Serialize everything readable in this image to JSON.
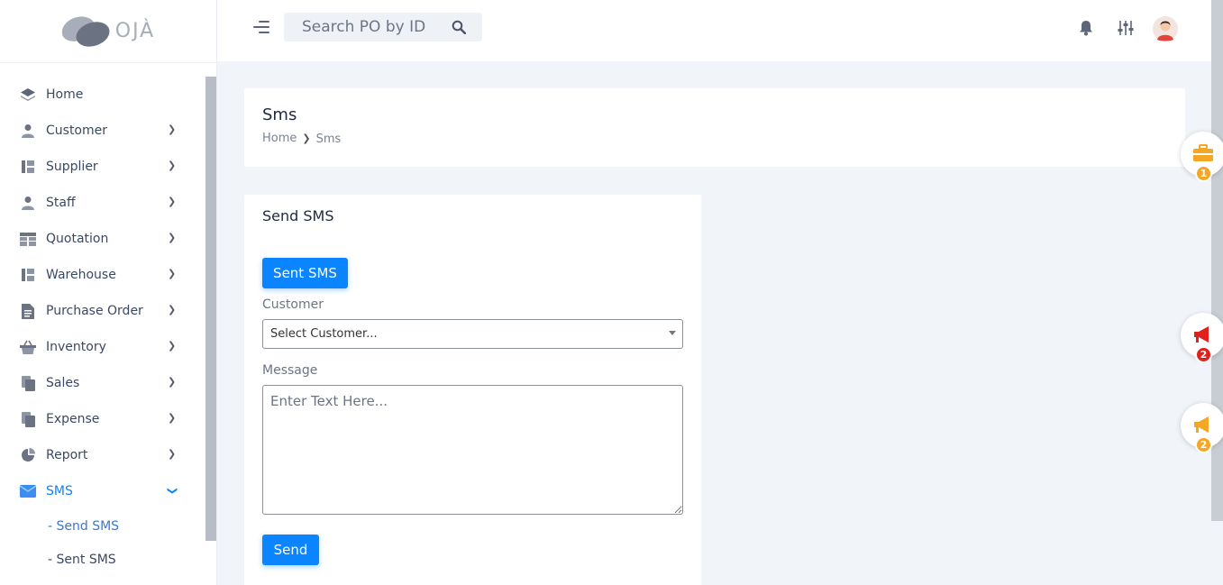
{
  "app": {
    "logo_text": "OJÀ"
  },
  "header": {
    "search_placeholder": "Search PO by ID",
    "icons": [
      "menu-icon",
      "search-icon",
      "bell-icon",
      "sliders-icon",
      "user-avatar"
    ]
  },
  "sidebar": {
    "items": [
      {
        "label": "Home",
        "icon": "layers-icon",
        "has_chevron": false
      },
      {
        "label": "Customer",
        "icon": "user-icon",
        "has_chevron": true
      },
      {
        "label": "Supplier",
        "icon": "columns-icon",
        "has_chevron": true
      },
      {
        "label": "Staff",
        "icon": "user-icon",
        "has_chevron": true
      },
      {
        "label": "Quotation",
        "icon": "table-icon",
        "has_chevron": true
      },
      {
        "label": "Warehouse",
        "icon": "columns-icon",
        "has_chevron": true
      },
      {
        "label": "Purchase Order",
        "icon": "document-icon",
        "has_chevron": true
      },
      {
        "label": "Inventory",
        "icon": "basket-icon",
        "has_chevron": true
      },
      {
        "label": "Sales",
        "icon": "copy-icon",
        "has_chevron": true
      },
      {
        "label": "Expense",
        "icon": "copy-icon",
        "has_chevron": true
      },
      {
        "label": "Report",
        "icon": "pie-chart-icon",
        "has_chevron": true
      },
      {
        "label": "SMS",
        "icon": "envelope-icon",
        "has_chevron": true,
        "expanded": true
      }
    ],
    "sms_subitems": [
      {
        "label": "- Send SMS",
        "active": true
      },
      {
        "label": "- Sent SMS",
        "active": false
      }
    ]
  },
  "page": {
    "title": "Sms",
    "breadcrumb": [
      "Home",
      "Sms"
    ]
  },
  "form": {
    "title": "Send SMS",
    "sent_button": "Sent SMS",
    "customer_label": "Customer",
    "customer_select_value": "Select Customer...",
    "message_label": "Message",
    "message_placeholder": "Enter Text Here...",
    "send_button": "Send"
  },
  "floating": [
    {
      "icon": "briefcase-icon",
      "badge": "1",
      "badge_color": "#f5a623"
    },
    {
      "icon": "megaphone-icon",
      "badge": "2",
      "badge_color": "#e0201b"
    },
    {
      "icon": "megaphone-icon",
      "badge": "2",
      "badge_color": "#f5a623"
    }
  ],
  "colors": {
    "accent": "#0a84ff",
    "background": "#f1f4f8",
    "text": "#3b4863"
  }
}
